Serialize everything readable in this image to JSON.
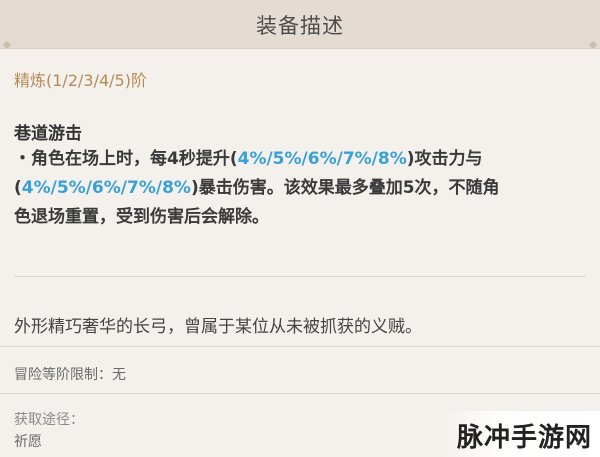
{
  "header": {
    "title": "装备描述"
  },
  "refinement": {
    "label": "精炼(1/2/3/4/5)阶"
  },
  "passive": {
    "name": "巷道游击",
    "line1_a": "・角色在场上时，每4秒提升(",
    "line1_hl": "4%/5%/6%/7%/8%",
    "line1_b": ")攻击力与",
    "line2_a": "(",
    "line2_hl": "4%/5%/6%/7%/8%",
    "line2_b": ")暴击伤害。该效果最多叠加5次，不随角",
    "line3": "色退场重置，受到伤害后会解除。"
  },
  "lore": {
    "text": "外形精巧奢华的长弓，曾属于某位从未被抓获的义贼。"
  },
  "level_limit": {
    "text": "冒险等阶限制：无"
  },
  "source": {
    "label": "获取途径：",
    "value": "祈愿"
  },
  "watermark": {
    "text": "脉冲手游网"
  },
  "colors": {
    "highlight": "#3aa0d8",
    "refine": "#b48b57"
  }
}
